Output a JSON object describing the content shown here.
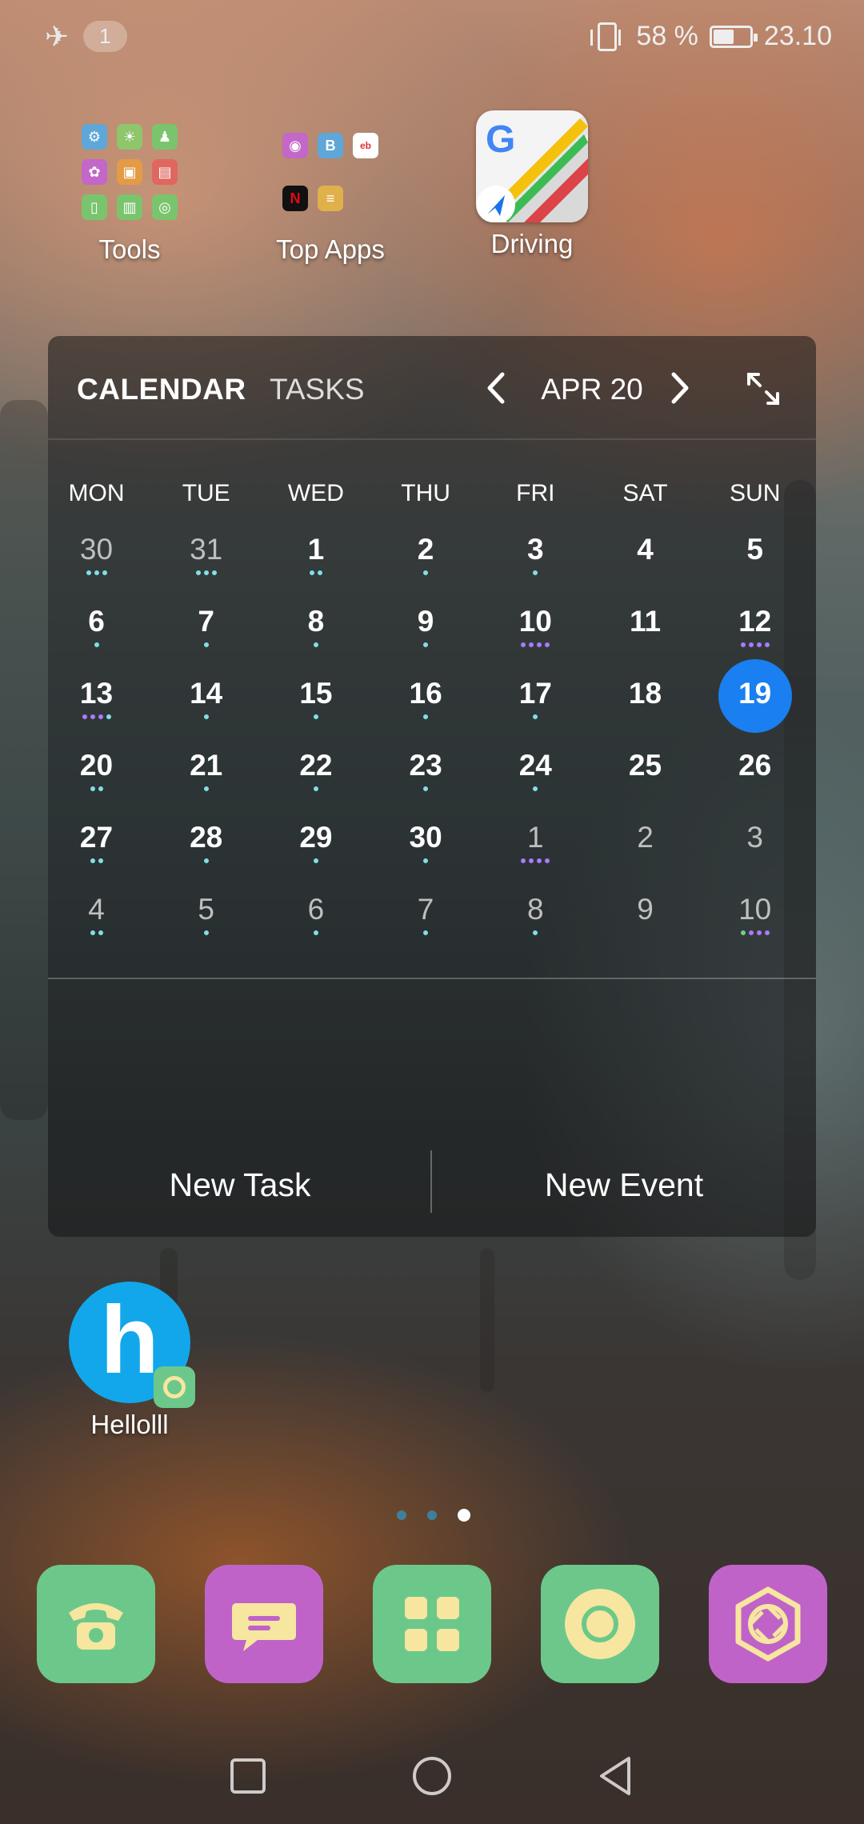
{
  "status_bar": {
    "notification_count": "1",
    "battery_percent": "58 %",
    "battery_level": 0.58,
    "time": "23.10",
    "icons": [
      "airplane-icon",
      "vibrate-icon",
      "battery-icon"
    ]
  },
  "home_apps": [
    {
      "label": "Tools",
      "icon": "tools-folder-icon"
    },
    {
      "label": "Top Apps",
      "icon": "top-apps-folder-icon"
    },
    {
      "label": "Driving",
      "icon": "google-maps-icon"
    }
  ],
  "widget": {
    "tabs": {
      "calendar": "CALENDAR",
      "tasks": "TASKS"
    },
    "month": "APR 20",
    "weekdays": [
      "MON",
      "TUE",
      "WED",
      "THU",
      "FRI",
      "SAT",
      "SUN"
    ],
    "weeks": [
      [
        "30",
        "31",
        "1",
        "2",
        "3",
        "4",
        "5"
      ],
      [
        "6",
        "7",
        "8",
        "9",
        "10",
        "11",
        "12"
      ],
      [
        "13",
        "14",
        "15",
        "16",
        "17",
        "18",
        "19"
      ],
      [
        "20",
        "21",
        "22",
        "23",
        "24",
        "25",
        "26"
      ],
      [
        "27",
        "28",
        "29",
        "30",
        "1",
        "2",
        "3"
      ],
      [
        "4",
        "5",
        "6",
        "7",
        "8",
        "9",
        "10"
      ]
    ],
    "today": "19",
    "new_task": "New Task",
    "new_event": "New Event",
    "colors": {
      "today": "#1a7ff0",
      "dot_teal": "#7fe0e6",
      "dot_purple": "#a77bff",
      "dot_green": "#6fd08a"
    }
  },
  "hello_app": {
    "label": "Hellolll",
    "glyph": "h"
  },
  "pager": {
    "pages": 3,
    "current": 3
  },
  "dock": [
    {
      "icon": "phone-icon",
      "color": "#6cc88a"
    },
    {
      "icon": "messages-icon",
      "color": "#c063c9"
    },
    {
      "icon": "apps-grid-icon",
      "color": "#6cc88a"
    },
    {
      "icon": "chrome-icon",
      "color": "#6cc88a"
    },
    {
      "icon": "camera-icon",
      "color": "#c063c9"
    }
  ],
  "nav": [
    "recents-button",
    "home-button",
    "back-button"
  ]
}
